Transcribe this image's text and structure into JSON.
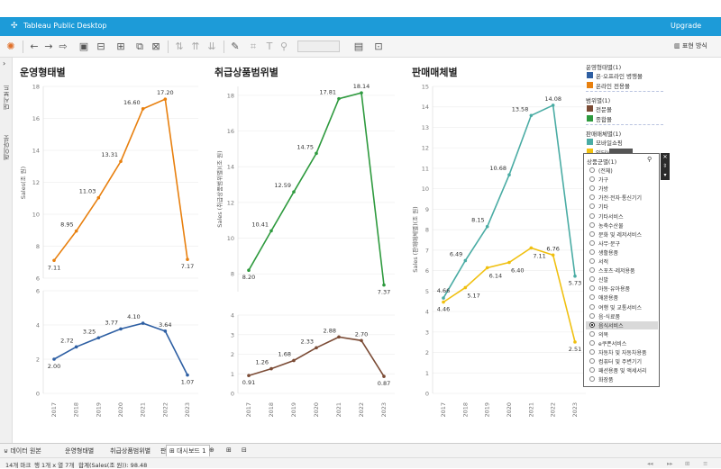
{
  "app": {
    "title": "Tableau Public Desktop",
    "upgrade": "Upgrade",
    "show_me": "표현 방식"
  },
  "sidebar": {
    "tabs": [
      "대시보드",
      "레이아웃"
    ]
  },
  "dashboard": {
    "sheets": [
      {
        "title": "운영형태별",
        "ylabel": "Sales(조 원)"
      },
      {
        "title": "취급상품범위별",
        "ylabel": "Sales (취급상품범위별)(조 원)"
      },
      {
        "title": "판매매체별",
        "ylabel": "Sales (판매매체별)(조 원)"
      }
    ]
  },
  "chart_data": [
    {
      "type": "line",
      "title": "운영형태별",
      "ylabel": "Sales(조 원)",
      "x": [
        "2017",
        "2018",
        "2019",
        "2020",
        "2021",
        "2022",
        "2023"
      ],
      "ylim": [
        6,
        18
      ],
      "yticks": [
        6,
        8,
        10,
        12,
        14,
        16,
        18
      ],
      "series": [
        {
          "name": "온라인 전용몰",
          "color": "#e8800f",
          "values": [
            7.11,
            8.95,
            11.03,
            13.31,
            16.6,
            17.2,
            7.17
          ]
        }
      ]
    },
    {
      "type": "line",
      "title": "운영형태별",
      "x": [
        "2017",
        "2018",
        "2019",
        "2020",
        "2021",
        "2022",
        "2023"
      ],
      "ylim": [
        0,
        6
      ],
      "yticks": [
        0,
        2,
        4,
        6
      ],
      "series": [
        {
          "name": "온·오프라인 병행몰",
          "color": "#2e5fa3",
          "values": [
            2.0,
            2.72,
            3.25,
            3.77,
            4.1,
            3.64,
            1.07
          ]
        }
      ]
    },
    {
      "type": "line",
      "title": "취급상품범위별",
      "ylabel": "Sales (취급상품범위별)(조 원)",
      "x": [
        "2017",
        "2018",
        "2019",
        "2020",
        "2021",
        "2022",
        "2023"
      ],
      "ylim": [
        7,
        18.5
      ],
      "yticks": [
        8,
        10,
        12,
        14,
        16,
        18
      ],
      "series": [
        {
          "name": "종합몰",
          "color": "#2e9a3e",
          "values": [
            8.2,
            10.41,
            12.59,
            14.75,
            17.81,
            18.14,
            7.37
          ]
        }
      ]
    },
    {
      "type": "line",
      "title": "취급상품범위별",
      "x": [
        "2017",
        "2018",
        "2019",
        "2020",
        "2021",
        "2022",
        "2023"
      ],
      "ylim": [
        0,
        4
      ],
      "yticks": [
        0,
        1,
        2,
        3,
        4
      ],
      "series": [
        {
          "name": "전문몰",
          "color": "#7b4b35",
          "values": [
            0.91,
            1.26,
            1.68,
            2.33,
            2.88,
            2.7,
            0.87
          ]
        }
      ]
    },
    {
      "type": "line",
      "title": "판매매체별",
      "ylabel": "Sales (판매매체별)(조 원)",
      "x": [
        "2017",
        "2018",
        "2019",
        "2020",
        "2021",
        "2022",
        "2023"
      ],
      "ylim": [
        0,
        15
      ],
      "yticks": [
        0,
        1,
        2,
        3,
        4,
        5,
        6,
        7,
        8,
        9,
        10,
        11,
        12,
        13,
        14,
        15
      ],
      "series": [
        {
          "name": "모바일쇼핑",
          "color": "#4aaca4",
          "values": [
            4.66,
            6.49,
            8.15,
            10.68,
            13.58,
            14.08,
            5.73
          ]
        },
        {
          "name": "인터넷쇼핑",
          "color": "#f0c010",
          "values": [
            4.46,
            5.17,
            6.14,
            6.4,
            7.11,
            6.76,
            2.51
          ]
        }
      ]
    }
  ],
  "legends": [
    {
      "title": "운영형태별(1)",
      "items": [
        {
          "label": "온·오프라인 병행몰",
          "color": "#2e5fa3"
        },
        {
          "label": "온라인 전용몰",
          "color": "#e8800f"
        }
      ]
    },
    {
      "title": "범위별(1)",
      "items": [
        {
          "label": "전문몰",
          "color": "#7b4b35"
        },
        {
          "label": "종합몰",
          "color": "#2e9a3e"
        }
      ]
    },
    {
      "title": "판매매체별(1)",
      "items": [
        {
          "label": "모바일쇼핑",
          "color": "#4aaca4"
        },
        {
          "label": "인터넷쇼핑",
          "color": "#f0c010"
        }
      ]
    }
  ],
  "filter": {
    "title": "상품군별(1)",
    "selected": "음식서비스",
    "items": [
      "(전체)",
      "가구",
      "가방",
      "가전·전자·통신기기",
      "기타",
      "기타서비스",
      "농축수산물",
      "문화 및 레저서비스",
      "사무·문구",
      "생활용품",
      "서적",
      "스포츠·레저용품",
      "신발",
      "아동·유아용품",
      "애완용품",
      "여행 및 교통서비스",
      "음·식료품",
      "음식서비스",
      "의복",
      "e쿠폰서비스",
      "자동차 및 자동차용품",
      "컴퓨터 및 주변기기",
      "패션용품 및 액세서리",
      "화장품"
    ]
  },
  "tabs": {
    "datasource": "데이터 원본",
    "sheets": [
      "운영형태별",
      "취급상품범위별",
      "판매매체별",
      "대시보드 1"
    ]
  },
  "status": {
    "marks": "14개 마크",
    "rowscols": "행 1개 x 열 7개",
    "sum": "합계(Sales(조 원)): 98.48"
  }
}
